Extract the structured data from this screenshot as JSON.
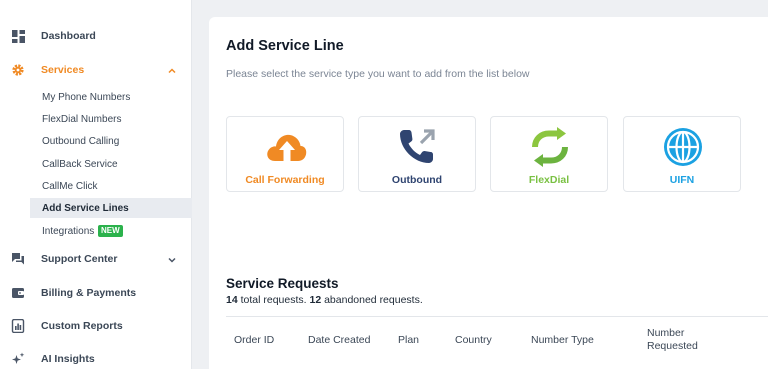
{
  "sidebar": {
    "dashboard": {
      "label": "Dashboard",
      "icon": "dashboard-grid-icon"
    },
    "services": {
      "label": "Services",
      "icon": "gear-icon",
      "color": "#f08a24"
    },
    "services_sub": [
      {
        "label": "My Phone Numbers"
      },
      {
        "label": "FlexDial Numbers"
      },
      {
        "label": "Outbound Calling"
      },
      {
        "label": "CallBack Service"
      },
      {
        "label": "CallMe Click"
      },
      {
        "label": "Add Service Lines"
      },
      {
        "label": "Integrations",
        "badge": "NEW"
      }
    ],
    "support_center": {
      "label": "Support Center",
      "icon": "chat-bubbles-icon"
    },
    "billing": {
      "label": "Billing & Payments",
      "icon": "wallet-icon"
    },
    "custom_reports": {
      "label": "Custom Reports",
      "icon": "report-icon"
    },
    "ai_insights": {
      "label": "AI Insights",
      "icon": "sparkle-icon"
    }
  },
  "main": {
    "title": "Add Service Line",
    "subtitle": "Please select the service type you want to add from the list below",
    "cards": [
      {
        "label": "Call Forwarding",
        "icon": "cloud-upload-icon",
        "color": "#f08a24"
      },
      {
        "label": "Outbound",
        "icon": "phone-outgoing-icon",
        "color": "#2f4470"
      },
      {
        "label": "FlexDial",
        "icon": "refresh-arrows-icon",
        "color": "#7ac143"
      },
      {
        "label": "UIFN",
        "icon": "globe-icon",
        "color": "#1ba1e2"
      }
    ],
    "service_requests": {
      "title": "Service Requests",
      "total": "14",
      "total_text": " total requests. ",
      "abandoned": "12",
      "abandoned_text": " abandoned requests."
    },
    "table_headers": [
      "Order ID",
      "Date Created",
      "Plan",
      "Country",
      "Number Type",
      "Number",
      "Requested"
    ]
  }
}
